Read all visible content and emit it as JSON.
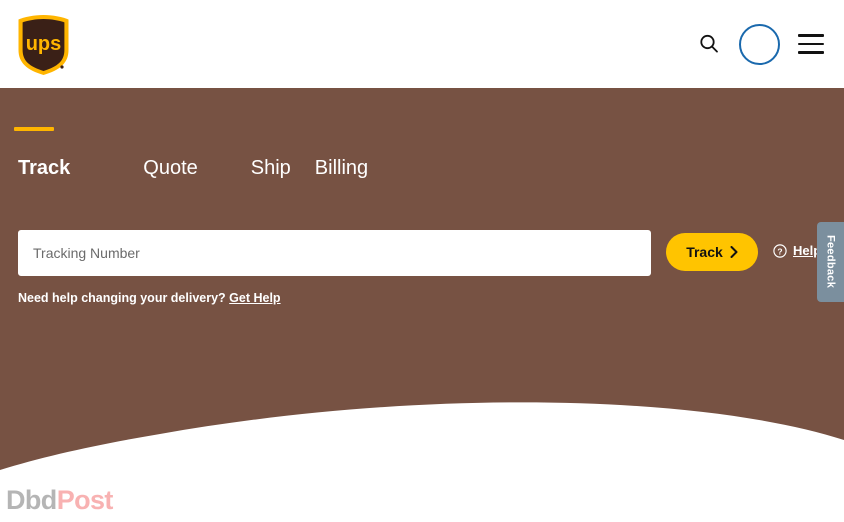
{
  "brand": {
    "logo_name": "ups-shield-logo",
    "logo_text": "ups",
    "shield_dark": "#3a2017",
    "shield_gold": "#ffb500"
  },
  "colors": {
    "hero_brown": "#775243",
    "accent_gold": "#ffc400",
    "underline_gold": "#ffb500",
    "account_blue": "#1a69ad",
    "feedback_gray": "#7b8f9e",
    "page_background": "#ffffff"
  },
  "header": {
    "search_icon": "search-icon",
    "account_icon": "account-circle-icon",
    "menu_icon": "hamburger-menu-icon"
  },
  "hero": {
    "tabs": [
      {
        "label": "Track",
        "active": true
      },
      {
        "label": "Quote",
        "active": false
      },
      {
        "label": "Ship",
        "active": false
      },
      {
        "label": "Billing",
        "active": false
      }
    ],
    "search": {
      "placeholder": "Tracking Number",
      "value": "",
      "button_label": "Track",
      "button_icon": "chevron-right-icon"
    },
    "help": {
      "icon": "question-circle-icon",
      "label": "Help"
    },
    "need_help": {
      "text": "Need help changing your delivery?",
      "link_label": "Get Help"
    }
  },
  "feedback": {
    "label": "Feedback"
  },
  "watermark": {
    "part_one": "Dbd",
    "part_two": "Post"
  }
}
